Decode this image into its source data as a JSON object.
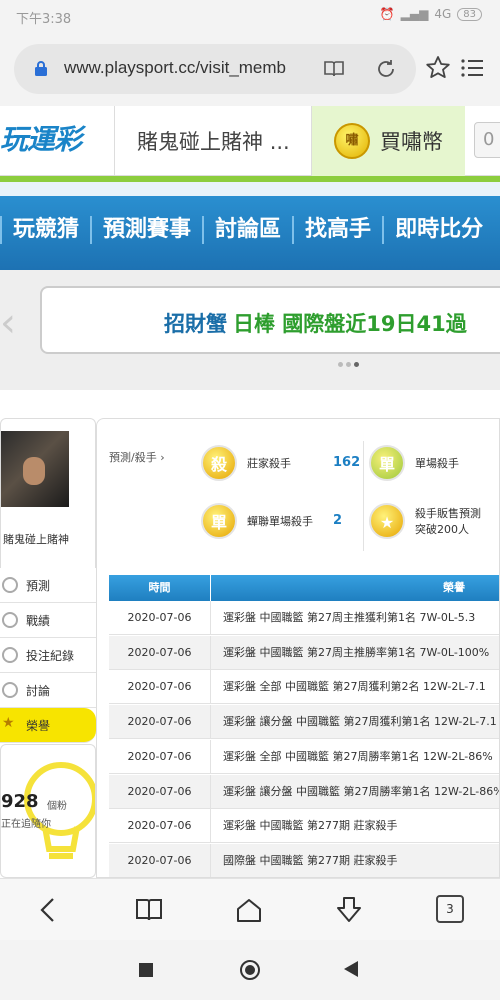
{
  "status_bar": {
    "time": "下午3:38",
    "network": "4G",
    "battery": "83"
  },
  "browser": {
    "url": "www.playsport.cc/visit_memb"
  },
  "site_tabs": {
    "logo_text": "玩運彩",
    "tab_user": "賭鬼碰上賭神",
    "tab_user_more": "...",
    "coin_icon_char": "嘯",
    "tab_buy": "買嘯幣",
    "tab_num": "0"
  },
  "nav": {
    "items": [
      "玩競猜",
      "預測賽事",
      "討論區",
      "找高手",
      "即時比分"
    ]
  },
  "banner": {
    "name": "招財蟹",
    "rest": "日棒 國際盤近19日41過"
  },
  "profile": {
    "username": "賭鬼碰上賭神",
    "menu": [
      {
        "label": "預測",
        "icon": "target-icon"
      },
      {
        "label": "戰績",
        "icon": "chart-icon"
      },
      {
        "label": "投注紀錄",
        "icon": "record-icon"
      },
      {
        "label": "討論",
        "icon": "chat-icon"
      },
      {
        "label": "榮譽",
        "icon": "star-icon"
      }
    ],
    "fans_count": "928",
    "fans_unit": "個粉",
    "fans_text": "正在追隨你"
  },
  "stats": {
    "breadcrumb": "預測/殺手",
    "badges": [
      {
        "label": "莊家殺手",
        "value": "162",
        "icon_char": "殺"
      },
      {
        "label": "單場殺手",
        "value": "",
        "icon_char": "單"
      },
      {
        "label": "蟬聯單場殺手",
        "value": "2",
        "icon_char": "單"
      },
      {
        "label": "殺手販售預測突破200人",
        "value": "",
        "icon_char": ""
      }
    ],
    "badge4_line1": "殺手販售預測",
    "badge4_line2": "突破200人"
  },
  "table": {
    "headers": [
      "時間",
      "榮譽"
    ],
    "rows": [
      {
        "date": "2020-07-06",
        "honor": "運彩盤 中國職籃 第27周主推獲利第1名 7W-0L-5.3"
      },
      {
        "date": "2020-07-06",
        "honor": "運彩盤 中國職籃 第27周主推勝率第1名 7W-0L-100%"
      },
      {
        "date": "2020-07-06",
        "honor": "運彩盤 全部 中國職籃 第27周獲利第2名 12W-2L-7.1"
      },
      {
        "date": "2020-07-06",
        "honor": "運彩盤 讓分盤 中國職籃 第27周獲利第1名 12W-2L-7.1"
      },
      {
        "date": "2020-07-06",
        "honor": "運彩盤 全部 中國職籃 第27周勝率第1名 12W-2L-86%"
      },
      {
        "date": "2020-07-06",
        "honor": "運彩盤 讓分盤 中國職籃 第27周勝率第1名 12W-2L-86%"
      },
      {
        "date": "2020-07-06",
        "honor": "運彩盤 中國職籃 第277期 莊家殺手"
      },
      {
        "date": "2020-07-06",
        "honor": "國際盤 中國職籃 第277期 莊家殺手"
      }
    ]
  },
  "toolbar": {
    "tab_count": "3"
  }
}
